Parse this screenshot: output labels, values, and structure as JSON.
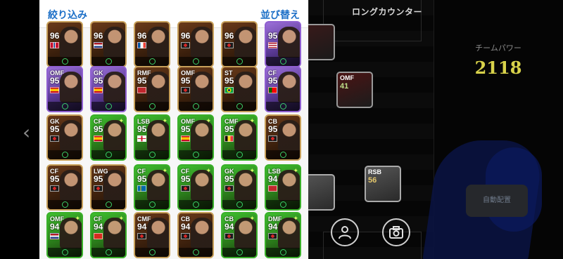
{
  "header": {
    "filter_label": "絞り込み",
    "sort_label": "並び替え"
  },
  "formation": {
    "title": "ロングカウンター"
  },
  "team": {
    "power_label": "チームパワー",
    "power_value": "2118",
    "auto_assign_label": "自動配置"
  },
  "pitch_players": [
    {
      "pos": "",
      "rating": "",
      "style": "dark"
    },
    {
      "pos": "OMF",
      "rating": "41",
      "style": "dark"
    },
    {
      "pos": "RSB",
      "rating": "56",
      "style": "grey"
    },
    {
      "pos": "",
      "rating": "",
      "style": "grey"
    }
  ],
  "cards": [
    {
      "pos": "",
      "rating": "96",
      "style": "gold",
      "flag": "norway"
    },
    {
      "pos": "",
      "rating": "96",
      "style": "gold",
      "flag": "netherlands"
    },
    {
      "pos": "",
      "rating": "96",
      "style": "gold",
      "flag": "france"
    },
    {
      "pos": "",
      "rating": "96",
      "style": "gold",
      "flag": "club"
    },
    {
      "pos": "",
      "rating": "96",
      "style": "gold",
      "flag": "club"
    },
    {
      "pos": "",
      "rating": "95",
      "style": "purple",
      "flag": "usa"
    },
    {
      "pos": "OMF",
      "rating": "95",
      "style": "purple",
      "flag": "spain"
    },
    {
      "pos": "GK",
      "rating": "95",
      "style": "purple",
      "flag": "spain"
    },
    {
      "pos": "RMF",
      "rating": "95",
      "style": "gold",
      "flag": "morocco"
    },
    {
      "pos": "OMF",
      "rating": "95",
      "style": "gold",
      "flag": "club"
    },
    {
      "pos": "ST",
      "rating": "95",
      "style": "gold",
      "flag": "brazil"
    },
    {
      "pos": "CF",
      "rating": "95",
      "style": "purple",
      "flag": "portugal"
    },
    {
      "pos": "GK",
      "rating": "95",
      "style": "gold",
      "flag": "club"
    },
    {
      "pos": "CF",
      "rating": "95",
      "style": "green",
      "flag": "spain"
    },
    {
      "pos": "LSB",
      "rating": "95",
      "style": "green",
      "flag": "england"
    },
    {
      "pos": "OMF",
      "rating": "95",
      "style": "green",
      "flag": "spain"
    },
    {
      "pos": "CMF",
      "rating": "95",
      "style": "green",
      "flag": "belgium"
    },
    {
      "pos": "CB",
      "rating": "95",
      "style": "gold",
      "flag": "club"
    },
    {
      "pos": "CF",
      "rating": "95",
      "style": "gold",
      "flag": "club"
    },
    {
      "pos": "LWG",
      "rating": "95",
      "style": "gold",
      "flag": "club"
    },
    {
      "pos": "CF",
      "rating": "95",
      "style": "green",
      "flag": "sweden"
    },
    {
      "pos": "CF",
      "rating": "95",
      "style": "green",
      "flag": "club"
    },
    {
      "pos": "GK",
      "rating": "95",
      "style": "green",
      "flag": "club"
    },
    {
      "pos": "LSB",
      "rating": "94",
      "style": "green",
      "flag": "morocco"
    },
    {
      "pos": "OMF",
      "rating": "94",
      "style": "green",
      "flag": "netherlands"
    },
    {
      "pos": "CF",
      "rating": "94",
      "style": "green",
      "flag": "switzerland"
    },
    {
      "pos": "CMF",
      "rating": "94",
      "style": "gold",
      "flag": "club"
    },
    {
      "pos": "CB",
      "rating": "94",
      "style": "gold",
      "flag": "club"
    },
    {
      "pos": "CB",
      "rating": "94",
      "style": "green",
      "flag": "club"
    },
    {
      "pos": "DMF",
      "rating": "94",
      "style": "green",
      "flag": "club"
    }
  ],
  "colors": {
    "accent": "#1c6fc7",
    "power": "#d8d24a"
  }
}
